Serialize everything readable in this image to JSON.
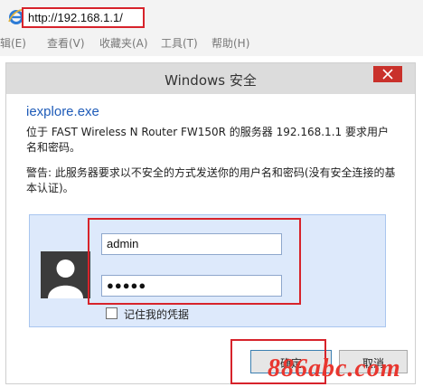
{
  "browser": {
    "url": "http://192.168.1.1/",
    "menu": [
      "辑(E)",
      "查看(V)",
      "收藏夹(A)",
      "工具(T)",
      "帮助(H)"
    ]
  },
  "dialog": {
    "title": "Windows 安全",
    "app_name": "iexplore.exe",
    "message": "位于 FAST Wireless N Router FW150R 的服务器 192.168.1.1 要求用户名和密码。",
    "warning": "警告: 此服务器要求以不安全的方式发送你的用户名和密码(没有安全连接的基本认证)。",
    "username_value": "admin",
    "password_mask": "●●●●●",
    "remember_label": "记住我的凭据",
    "ok_label": "确定",
    "cancel_label": "取消"
  },
  "watermark": "886abc.com",
  "colors": {
    "highlight_red": "#d7232b",
    "title_bar": "#dcdcdc",
    "close_red": "#c9312b",
    "panel_blue": "#dde9fb",
    "link_blue": "#1e5bb8"
  },
  "icons": [
    "ie-icon",
    "close-icon",
    "user-avatar-icon"
  ]
}
